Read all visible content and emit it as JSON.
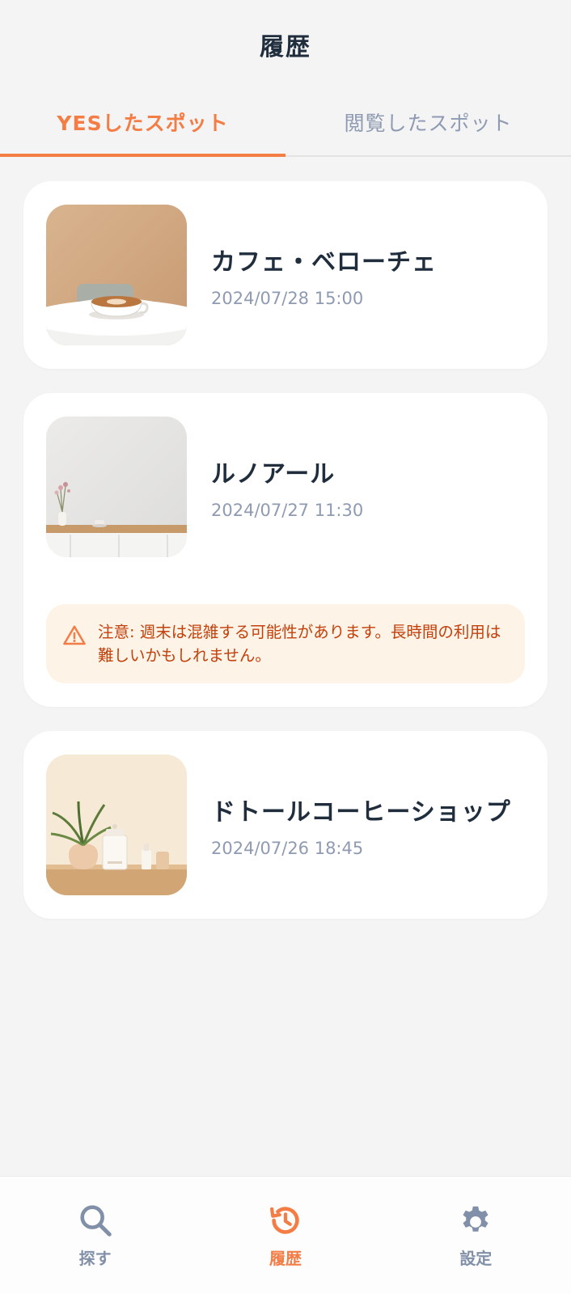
{
  "header": {
    "title": "履歴"
  },
  "tabs": [
    {
      "label": "YESしたスポット",
      "active": true
    },
    {
      "label": "閲覧したスポット",
      "active": false
    }
  ],
  "spots": [
    {
      "name": "カフェ・ベローチェ",
      "time": "2024/07/28 15:00",
      "image": "latte-cup-on-table"
    },
    {
      "name": "ルノアール",
      "time": "2024/07/27 11:30",
      "image": "vase-on-shelf",
      "notice": {
        "icon": "warning-icon",
        "text": "注意: 週末は混雑する可能性があります。長時間の利用は難しいかもしれません。"
      }
    },
    {
      "name": "ドトールコーヒーショップ",
      "time": "2024/07/26 18:45",
      "image": "plant-and-jars"
    }
  ],
  "nav": [
    {
      "label": "探す",
      "icon": "search-icon",
      "active": false
    },
    {
      "label": "履歴",
      "icon": "history-icon",
      "active": true
    },
    {
      "label": "設定",
      "icon": "gear-icon",
      "active": false
    }
  ],
  "colors": {
    "accent": "#f47c45",
    "text": "#1f2d3d",
    "muted": "#8f9bb2",
    "warning_bg": "#fdf3e6",
    "warning_text": "#c2410c"
  }
}
